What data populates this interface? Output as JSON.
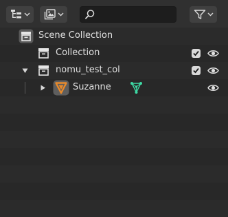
{
  "header": {
    "search_placeholder": "",
    "icons": {
      "display_mode": "outliner-tree-icon",
      "view_layer": "view-layer-icon",
      "search": "search-icon",
      "filter": "filter-icon"
    }
  },
  "rows": {
    "scene": {
      "label": "Scene Collection",
      "icon": "scene-collection-icon"
    },
    "collection": {
      "label": "Collection",
      "icon": "collection-icon",
      "include": true,
      "visible": true
    },
    "nomu": {
      "label": "nomu_test_col",
      "icon": "collection-icon",
      "expanded": true,
      "include": true,
      "visible": true
    },
    "suzanne": {
      "label": "Suzanne",
      "icon": "mesh-object-icon",
      "data_icon": "mesh-data-icon",
      "expanded": false,
      "visible": true
    }
  },
  "colors": {
    "panel_bg": "#282828",
    "header_bg": "#303030",
    "row_alt": "#2b2b2b",
    "mesh_object_orange": "#e88a2b",
    "mesh_data_green": "#3ed9a4"
  }
}
